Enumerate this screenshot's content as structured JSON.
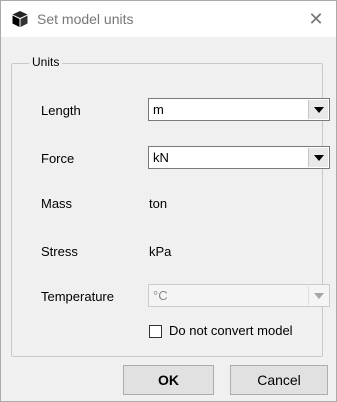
{
  "window": {
    "title": "Set model units",
    "close_glyph": "✕"
  },
  "group": {
    "legend": "Units"
  },
  "fields": {
    "length": {
      "label": "Length",
      "value": "m"
    },
    "force": {
      "label": "Force",
      "value": "kN"
    },
    "mass": {
      "label": "Mass",
      "value": "ton"
    },
    "stress": {
      "label": "Stress",
      "value": "kPa"
    },
    "temperature": {
      "label": "Temperature",
      "value": "°C"
    }
  },
  "options": {
    "do_not_convert_label": "Do not convert model",
    "do_not_convert_checked": false
  },
  "buttons": {
    "ok": "OK",
    "cancel": "Cancel"
  },
  "icons": {
    "title_icon": "cube-icon",
    "dropdown_icon": "chevron-down-icon"
  }
}
